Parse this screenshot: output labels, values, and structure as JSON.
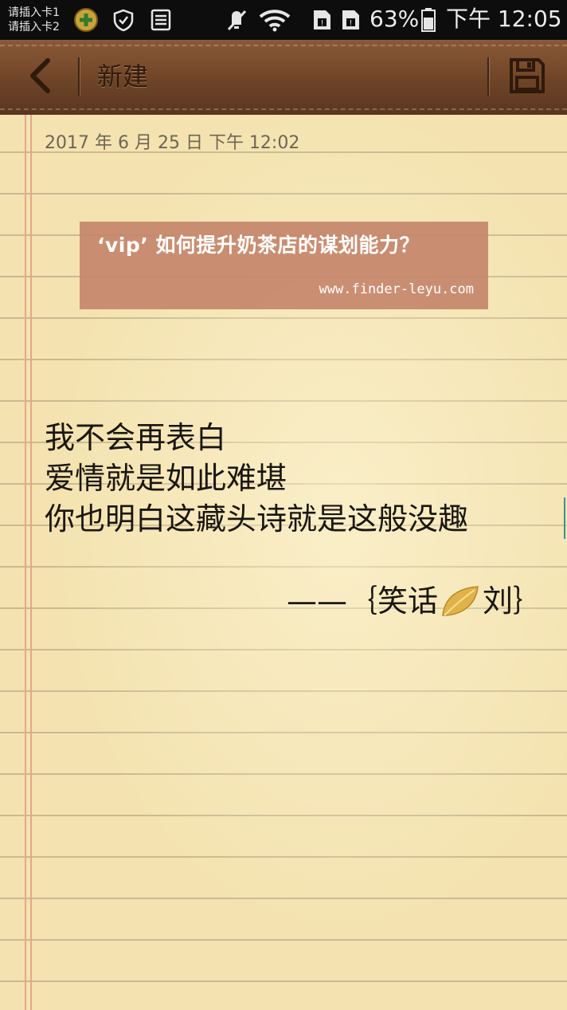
{
  "status_bar": {
    "sim1": "请插入卡1",
    "sim2": "请插入卡2",
    "battery_percent": "63%",
    "time": "下午 12:05",
    "icons": [
      "app-badge-icon",
      "shield-icon",
      "storage-icon",
      "mute-icon",
      "wifi-icon",
      "sim-no-card-icon",
      "sim-no-card-icon",
      "battery-icon"
    ]
  },
  "toolbar": {
    "back_icon": "chevron-left-icon",
    "title": "新建",
    "save_icon": "save-icon"
  },
  "note": {
    "date": "2017 年 6 月 25 日 下午 12:02",
    "banner": {
      "title": "‘vip’  如何提升奶茶店的谋划能力？",
      "url": "www.finder-leyu.com"
    },
    "lines": [
      "我不会再表白",
      "爱情就是如此难堪",
      "你也明白这藏头诗就是这般没趣"
    ],
    "signature": {
      "prefix": "——｛笑话",
      "suffix": "刘｝",
      "leaf_icon": "golden-leaf-icon"
    }
  },
  "colors": {
    "toolbar": "#6e4427",
    "paper": "#f4e3b0",
    "banner": "#c4846a",
    "rule_line": "#cdb98f",
    "margin_line": "#e0a88c"
  }
}
